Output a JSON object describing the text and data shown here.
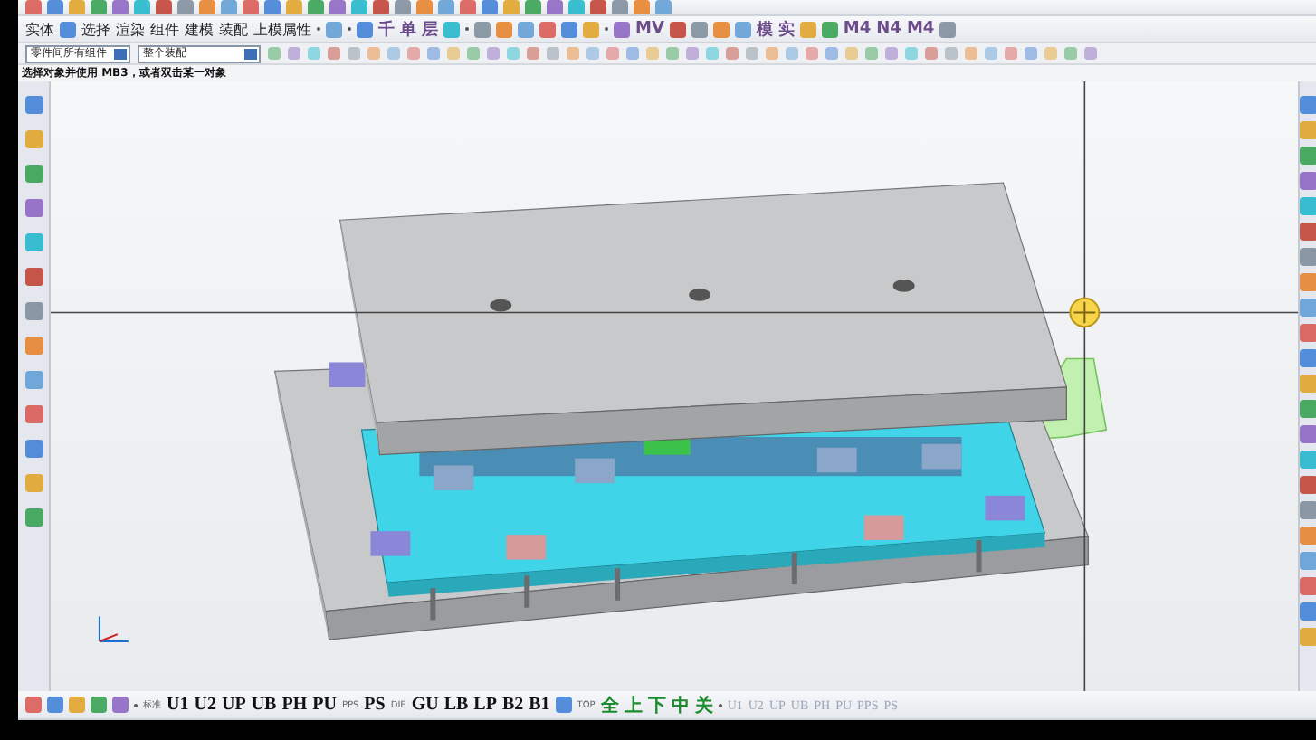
{
  "toolbar_row_1": {
    "items": [
      {
        "kind": "icon"
      },
      {
        "kind": "icon"
      },
      {
        "kind": "icon"
      },
      {
        "kind": "icon"
      },
      {
        "kind": "icon"
      },
      {
        "kind": "icon"
      },
      {
        "kind": "icon"
      },
      {
        "kind": "icon"
      },
      {
        "kind": "icon"
      },
      {
        "kind": "icon"
      },
      {
        "kind": "icon"
      },
      {
        "kind": "icon"
      },
      {
        "kind": "icon"
      },
      {
        "kind": "icon"
      },
      {
        "kind": "icon"
      },
      {
        "kind": "icon"
      },
      {
        "kind": "icon"
      },
      {
        "kind": "icon"
      },
      {
        "kind": "icon"
      },
      {
        "kind": "icon"
      },
      {
        "kind": "icon"
      },
      {
        "kind": "icon"
      },
      {
        "kind": "icon"
      },
      {
        "kind": "icon"
      },
      {
        "kind": "icon"
      },
      {
        "kind": "icon"
      },
      {
        "kind": "icon"
      },
      {
        "kind": "icon"
      },
      {
        "kind": "icon"
      },
      {
        "kind": "icon"
      }
    ]
  },
  "toolbar_row_2": {
    "items": [
      {
        "kind": "label",
        "text": "实体"
      },
      {
        "kind": "icon"
      },
      {
        "kind": "label",
        "text": "选择"
      },
      {
        "kind": "label",
        "text": "渲染"
      },
      {
        "kind": "label",
        "text": "组件"
      },
      {
        "kind": "label",
        "text": "建模"
      },
      {
        "kind": "label",
        "text": "装配"
      },
      {
        "kind": "label",
        "text": "上模属性"
      },
      {
        "kind": "sep"
      },
      {
        "kind": "icon"
      },
      {
        "kind": "sep"
      },
      {
        "kind": "icon"
      },
      {
        "kind": "glyph",
        "text": "千"
      },
      {
        "kind": "glyph",
        "text": "单"
      },
      {
        "kind": "glyph",
        "text": "层"
      },
      {
        "kind": "icon"
      },
      {
        "kind": "sep"
      },
      {
        "kind": "icon"
      },
      {
        "kind": "icon"
      },
      {
        "kind": "icon"
      },
      {
        "kind": "icon"
      },
      {
        "kind": "icon"
      },
      {
        "kind": "icon"
      },
      {
        "kind": "sep"
      },
      {
        "kind": "icon"
      },
      {
        "kind": "glyph",
        "text": "MV"
      },
      {
        "kind": "icon"
      },
      {
        "kind": "icon"
      },
      {
        "kind": "icon"
      },
      {
        "kind": "icon"
      },
      {
        "kind": "glyph",
        "text": "模"
      },
      {
        "kind": "glyph",
        "text": "实"
      },
      {
        "kind": "icon"
      },
      {
        "kind": "icon"
      },
      {
        "kind": "glyph",
        "text": "M4"
      },
      {
        "kind": "glyph",
        "text": "N4"
      },
      {
        "kind": "glyph",
        "text": "M4"
      },
      {
        "kind": "icon"
      }
    ]
  },
  "toolbar_row_3": {
    "filter_dropdown": "零件间所有组件",
    "scope_dropdown": "整个装配"
  },
  "status_line": "选择对象并使用 MB3，或者双击某一对象",
  "bottom_toolbar": {
    "items": [
      {
        "kind": "icon"
      },
      {
        "kind": "icon"
      },
      {
        "kind": "icon"
      },
      {
        "kind": "icon"
      },
      {
        "kind": "icon"
      },
      {
        "kind": "sep"
      },
      {
        "kind": "small",
        "text": "标准"
      },
      {
        "kind": "label",
        "text": "U1"
      },
      {
        "kind": "label",
        "text": "U2"
      },
      {
        "kind": "label",
        "text": "UP"
      },
      {
        "kind": "label",
        "text": "UB"
      },
      {
        "kind": "label",
        "text": "PH"
      },
      {
        "kind": "label",
        "text": "PU"
      },
      {
        "kind": "small",
        "text": "PPS"
      },
      {
        "kind": "label",
        "text": "PS"
      },
      {
        "kind": "small",
        "text": "DIE"
      },
      {
        "kind": "label",
        "text": "GU"
      },
      {
        "kind": "label",
        "text": "LB"
      },
      {
        "kind": "label",
        "text": "LP"
      },
      {
        "kind": "label",
        "text": "B2"
      },
      {
        "kind": "label",
        "text": "B1"
      },
      {
        "kind": "icon"
      },
      {
        "kind": "small",
        "text": "TOP"
      },
      {
        "kind": "green",
        "text": "全"
      },
      {
        "kind": "green",
        "text": "上"
      },
      {
        "kind": "green",
        "text": "下"
      },
      {
        "kind": "green",
        "text": "中"
      },
      {
        "kind": "green",
        "text": "关"
      },
      {
        "kind": "sep"
      },
      {
        "kind": "faint",
        "text": "U1"
      },
      {
        "kind": "faint",
        "text": "U2"
      },
      {
        "kind": "faint",
        "text": "UP"
      },
      {
        "kind": "faint",
        "text": "UB"
      },
      {
        "kind": "faint",
        "text": "PH"
      },
      {
        "kind": "faint",
        "text": "PU"
      },
      {
        "kind": "faint",
        "text": "PPS"
      },
      {
        "kind": "faint",
        "text": "PS"
      }
    ]
  }
}
